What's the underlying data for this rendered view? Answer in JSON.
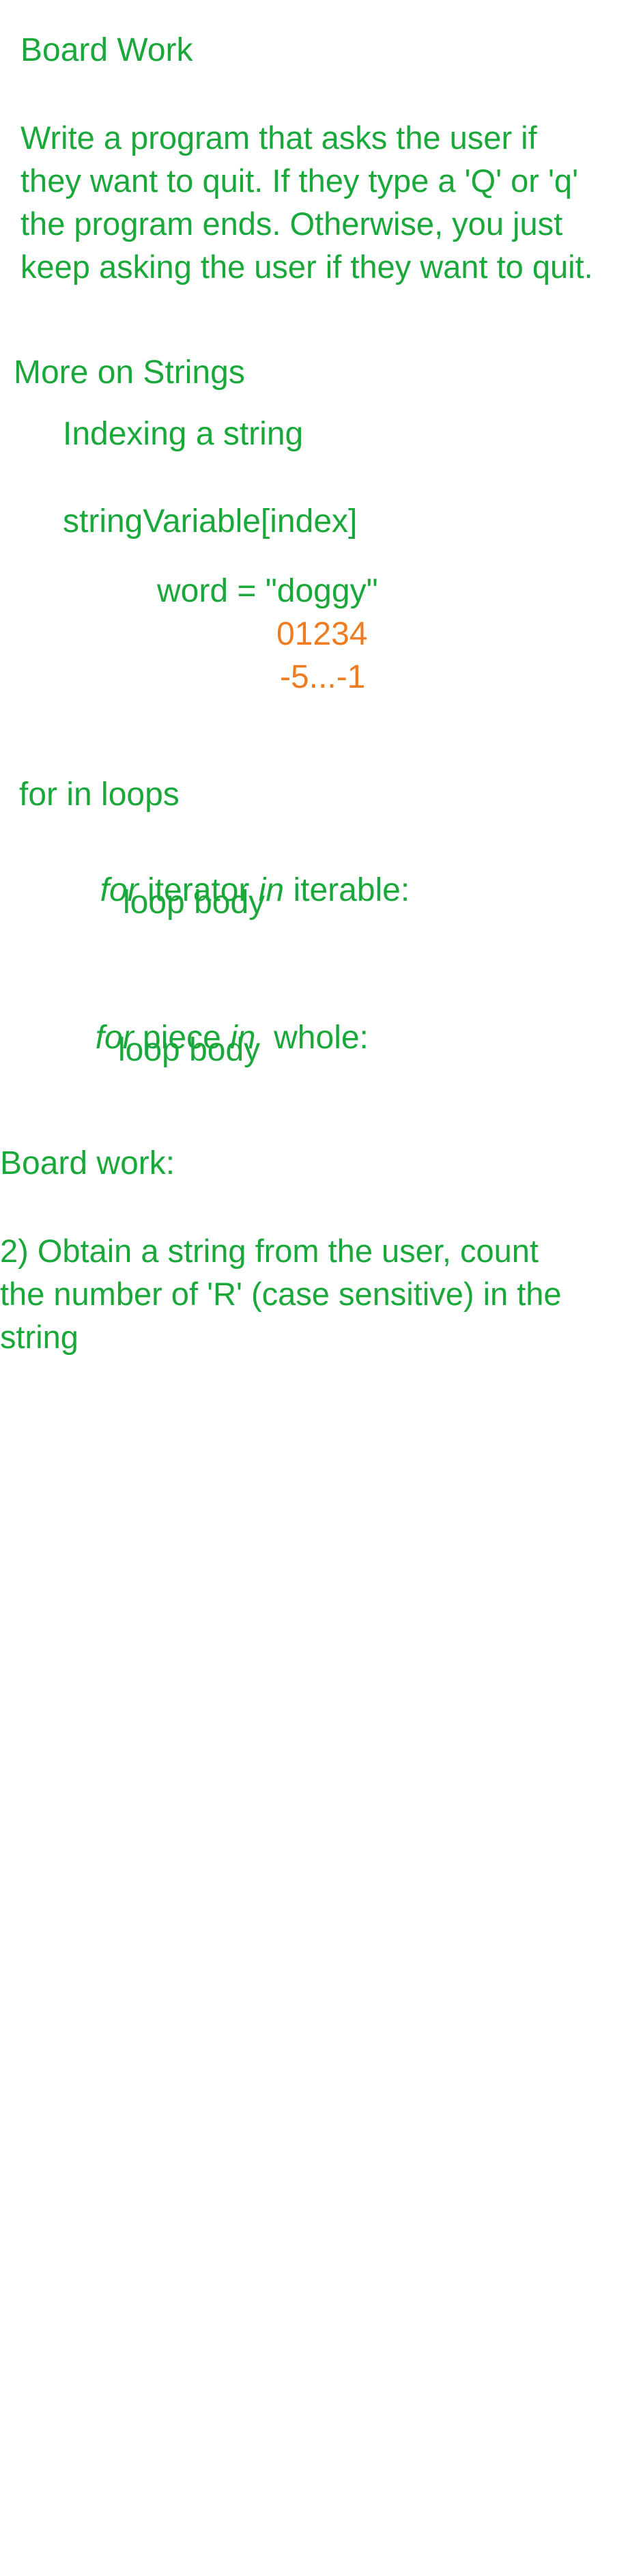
{
  "notes": {
    "board_work_title": "Board Work",
    "board_work_prompt": "Write a program that asks the user if\nthey want to quit. If they type a 'Q' or 'q'\nthe program ends. Otherwise, you just\nkeep asking the user if they want to quit.",
    "strings_heading": "More on Strings",
    "indexing_heading": "Indexing a string",
    "index_syntax": "stringVariable[index]",
    "word_example": "word = \"doggy\"",
    "positive_indices": "01234",
    "negative_indices": "-5...-1",
    "for_in_heading": "for in loops",
    "loop1": {
      "kw_for": "for",
      "iterator": " iterator ",
      "kw_in": "in",
      "iterable": " iterable:",
      "body": "loop body"
    },
    "loop2": {
      "kw_for": "for",
      "piece": " piece ",
      "kw_in": "in",
      "whole": "  whole:",
      "body": "loop body"
    },
    "board_work2_title": "Board work:",
    "board_work2_prompt": "2)  Obtain a string from the user, count\nthe number of 'R' (case sensitive) in the\nstring"
  },
  "colors": {
    "ink_green": "#1aa83a",
    "ink_orange": "#f07c22",
    "background": "#ffffff"
  }
}
